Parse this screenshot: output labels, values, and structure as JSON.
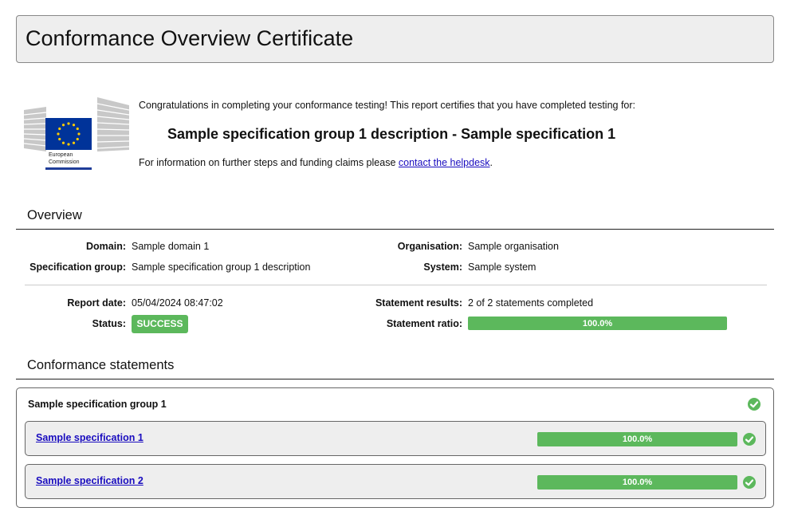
{
  "header": {
    "title": "Conformance Overview Certificate"
  },
  "logo": {
    "line1": "European",
    "line2": "Commission"
  },
  "intro": {
    "text": "Congratulations in completing your conformance testing! This report certifies that you have completed testing for:",
    "subject": "Sample specification group 1 description - Sample specification 1",
    "info_prefix": "For information on further steps and funding claims please ",
    "info_link": "contact the helpdesk",
    "info_suffix": "."
  },
  "overview": {
    "title": "Overview",
    "domain_label": "Domain:",
    "domain_value": "Sample domain 1",
    "spec_group_label": "Specification group:",
    "spec_group_value": "Sample specification group 1 description",
    "organisation_label": "Organisation:",
    "organisation_value": "Sample organisation",
    "system_label": "System:",
    "system_value": "Sample system",
    "report_date_label": "Report date:",
    "report_date_value": "05/04/2024 08:47:02",
    "status_label": "Status:",
    "status_value": "SUCCESS",
    "results_label": "Statement results:",
    "results_value": "2 of 2 statements completed",
    "ratio_label": "Statement ratio:",
    "ratio_text": "100.0%",
    "ratio_percent": 100
  },
  "statements": {
    "title": "Conformance statements",
    "group_name": "Sample specification group 1",
    "specs": [
      {
        "name": "Sample specification 1",
        "ratio_text": "100.0%",
        "ratio_percent": 100
      },
      {
        "name": "Sample specification 2",
        "ratio_text": "100.0%",
        "ratio_percent": 100
      }
    ]
  },
  "colors": {
    "success": "#5cb85c",
    "link": "#1a0dbf",
    "eu_blue": "#003399",
    "eu_star": "#ffcc00"
  }
}
